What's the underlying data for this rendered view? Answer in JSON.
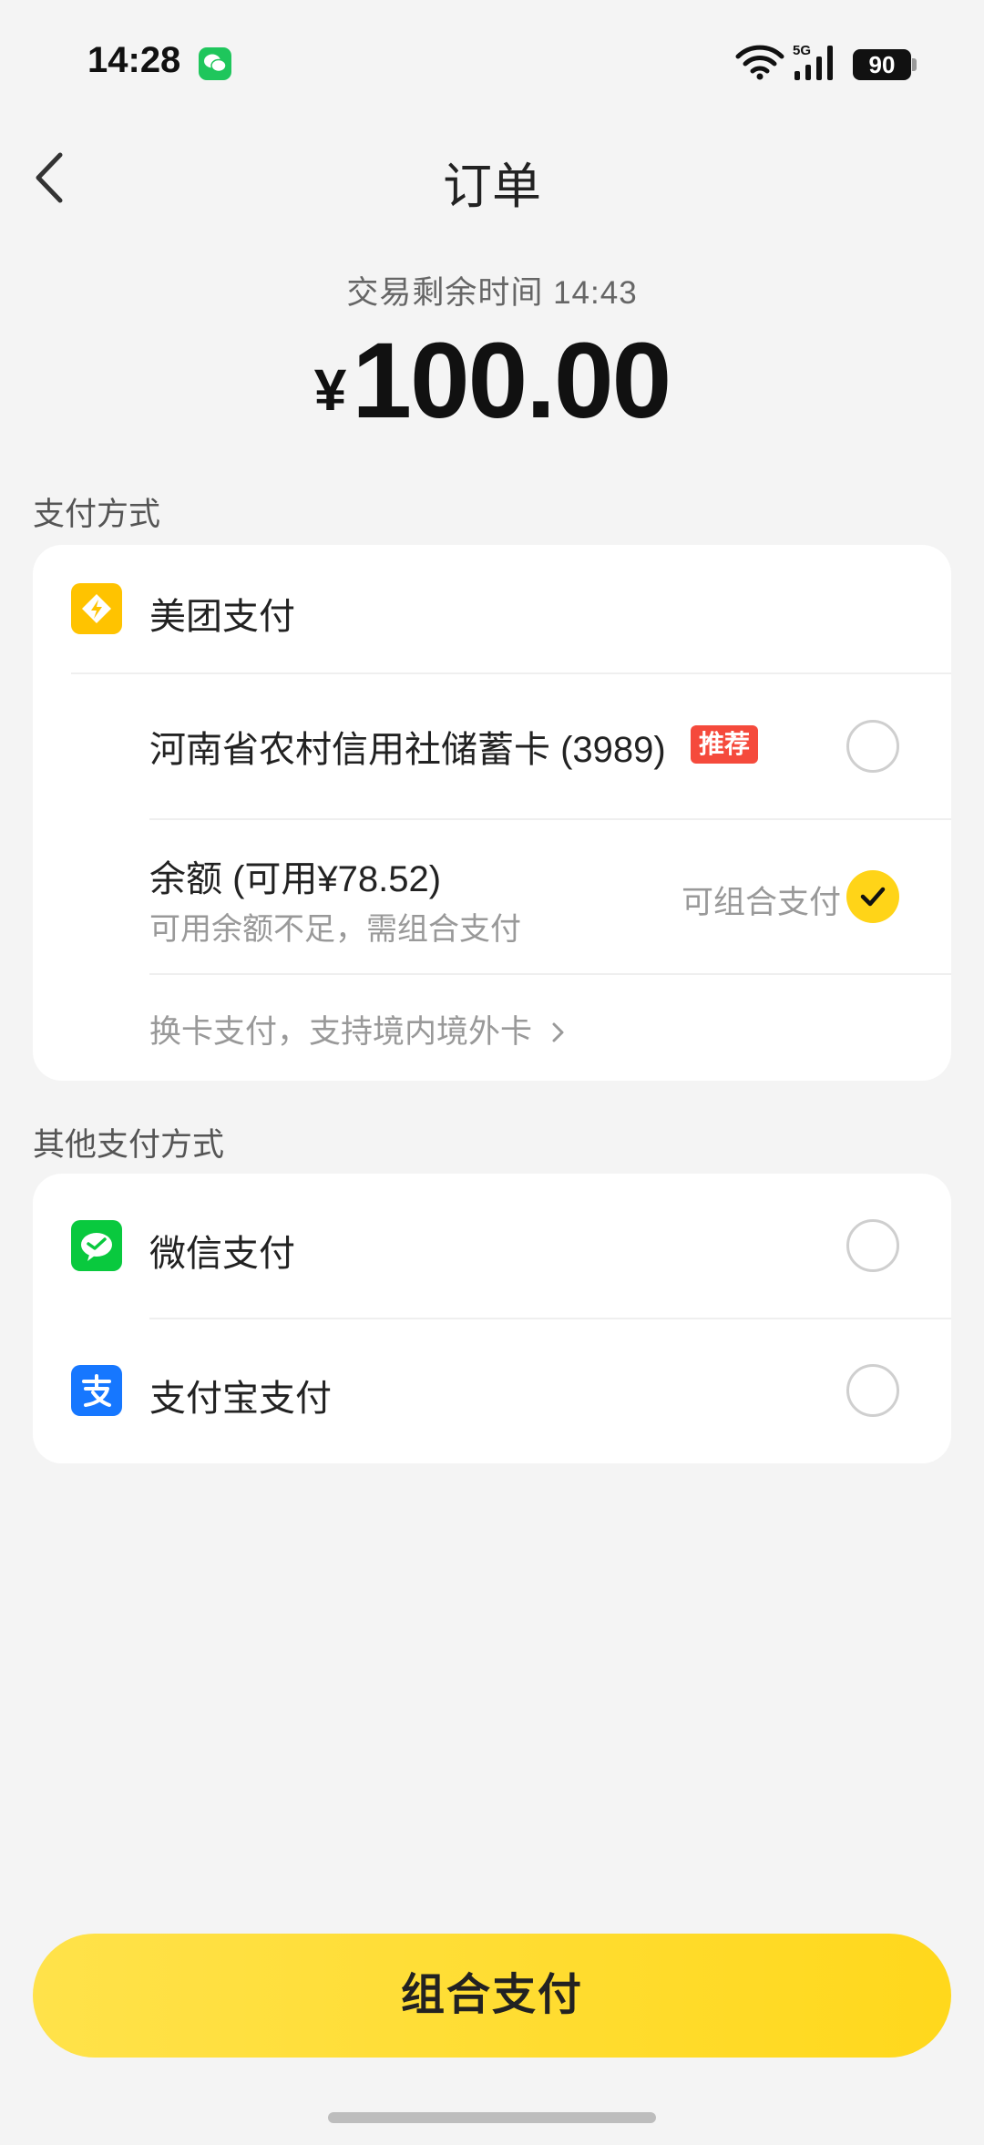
{
  "status_bar": {
    "time": "14:28",
    "network": "5G",
    "battery": "90",
    "icons": [
      "wechat-icon",
      "wifi-icon",
      "signal-icon",
      "battery-icon"
    ]
  },
  "header": {
    "title": "订单",
    "back_icon": "chevron-left-icon"
  },
  "order": {
    "timer_text": "交易剩余时间 14:43",
    "currency": "¥",
    "amount": "100.00"
  },
  "payment_methods": {
    "section_label": "支付方式",
    "provider": {
      "name": "美团支付",
      "icon": "meituan-pay-icon",
      "color": "#ffc300"
    },
    "options": [
      {
        "label": "河南省农村信用社储蓄卡 (3989)",
        "badge": "推荐",
        "selected": false
      },
      {
        "label": "余额 (可用¥78.52)",
        "sub": "可用余额不足，需组合支付",
        "hint": "可组合支付",
        "selected": true
      }
    ],
    "change_card": "换卡支付，支持境内境外卡"
  },
  "other_methods": {
    "section_label": "其他支付方式",
    "options": [
      {
        "label": "微信支付",
        "icon": "wechat-pay-icon",
        "color": "#09c93e",
        "selected": false
      },
      {
        "label": "支付宝支付",
        "icon": "alipay-icon",
        "color": "#1677ff",
        "selected": false
      }
    ]
  },
  "submit": {
    "label": "组合支付"
  },
  "colors": {
    "accent": "#ffd418",
    "badge": "#f54a3c",
    "background": "#f4f4f4"
  }
}
